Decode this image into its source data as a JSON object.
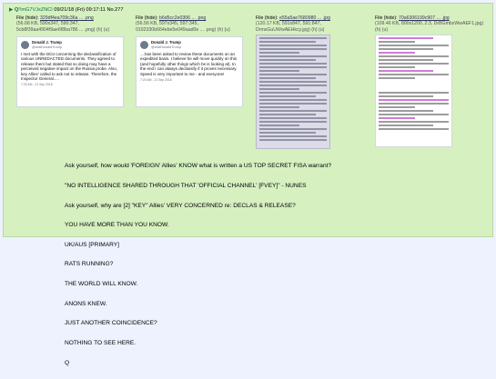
{
  "header": {
    "arrow": "▶",
    "name": "Q",
    "trip": "!!mG7VJxZNCI",
    "date": "09/21/18 (Fri) 09:17:11",
    "post_no": "No.277"
  },
  "files": [
    {
      "label": "File (hide):",
      "hash": "329df4ea709c36a ... .png",
      "meta": "(56.68 KB, 590x347, 590:347, 5cb8f39aa4904f9ae6f8ba786 ... .png) (h) (u)",
      "tweet": {
        "name": "Donald J. Trump",
        "handle": "@realDonaldTrump",
        "text": "I met with the DOJ concerning the declassification of various UNREDACTED documents. They agreed to release them but stated that so doing may have a perceived negative impact on the Russia probe. Also, key Allies' called to ask not to release. Therefore, the Inspector General.....",
        "time": "7:20 AM - 21 Sep 2018"
      }
    },
    {
      "label": "File (hide):",
      "hash": "b6d5cc2e0306 ... .png",
      "meta": "(56.56 KB, 597x345, 597:345, 0192330b664ebe5e049aad0e ... .png) (h) (u)",
      "tweet": {
        "name": "Donald J. Trump",
        "handle": "@realDonaldTrump",
        "text": "....has been asked to review these documents on an expedited basis. I believe he will move quickly on this (and hopefully other things which he is looking at). In the end I can always declassify if it proves necessary. Speed is very important to me - and everyone!",
        "time": "7:20 AM - 21 Sep 2018"
      }
    },
    {
      "label": "File (hide):",
      "hash": "e55a5ae7680980 ... .jpg",
      "meta": "(120.17 KB, 591x847, 591:847, DrmxGuUWwAEHkcy.jpg) (h) (u)"
    },
    {
      "label": "File (hide):",
      "hash": "70a6306199c907 ... .jpg",
      "meta": "(109.46 KB, 800x1200, 2:3, DrBGmbsWwAEF1.jpg) (h) (u)"
    }
  ],
  "message_lines": [
    "Ask yourself, how would 'FOREIGN' Allies' KNOW what is written a US TOP SECRET FISA warrant?",
    "\"NO INTELLIGENCE SHARED THROUGH THAT 'OFFICIAL CHANNEL' [FVEY]\" - NUNES",
    "Ask yourself, why are [2] \"KEY\" Allies' VERY CONCERNED re: DECLAS & RELEASE?",
    "YOU HAVE MORE THAN YOU KNOW.",
    "UK/AUS [PRIMARY]",
    "RATS RUNNING?",
    "THE WORLD WILL KNOW.",
    "ANONS KNEW.",
    "JUST ANOTHER COINCIDENCE?",
    "NOTHING TO SEE HERE.",
    "Q"
  ]
}
